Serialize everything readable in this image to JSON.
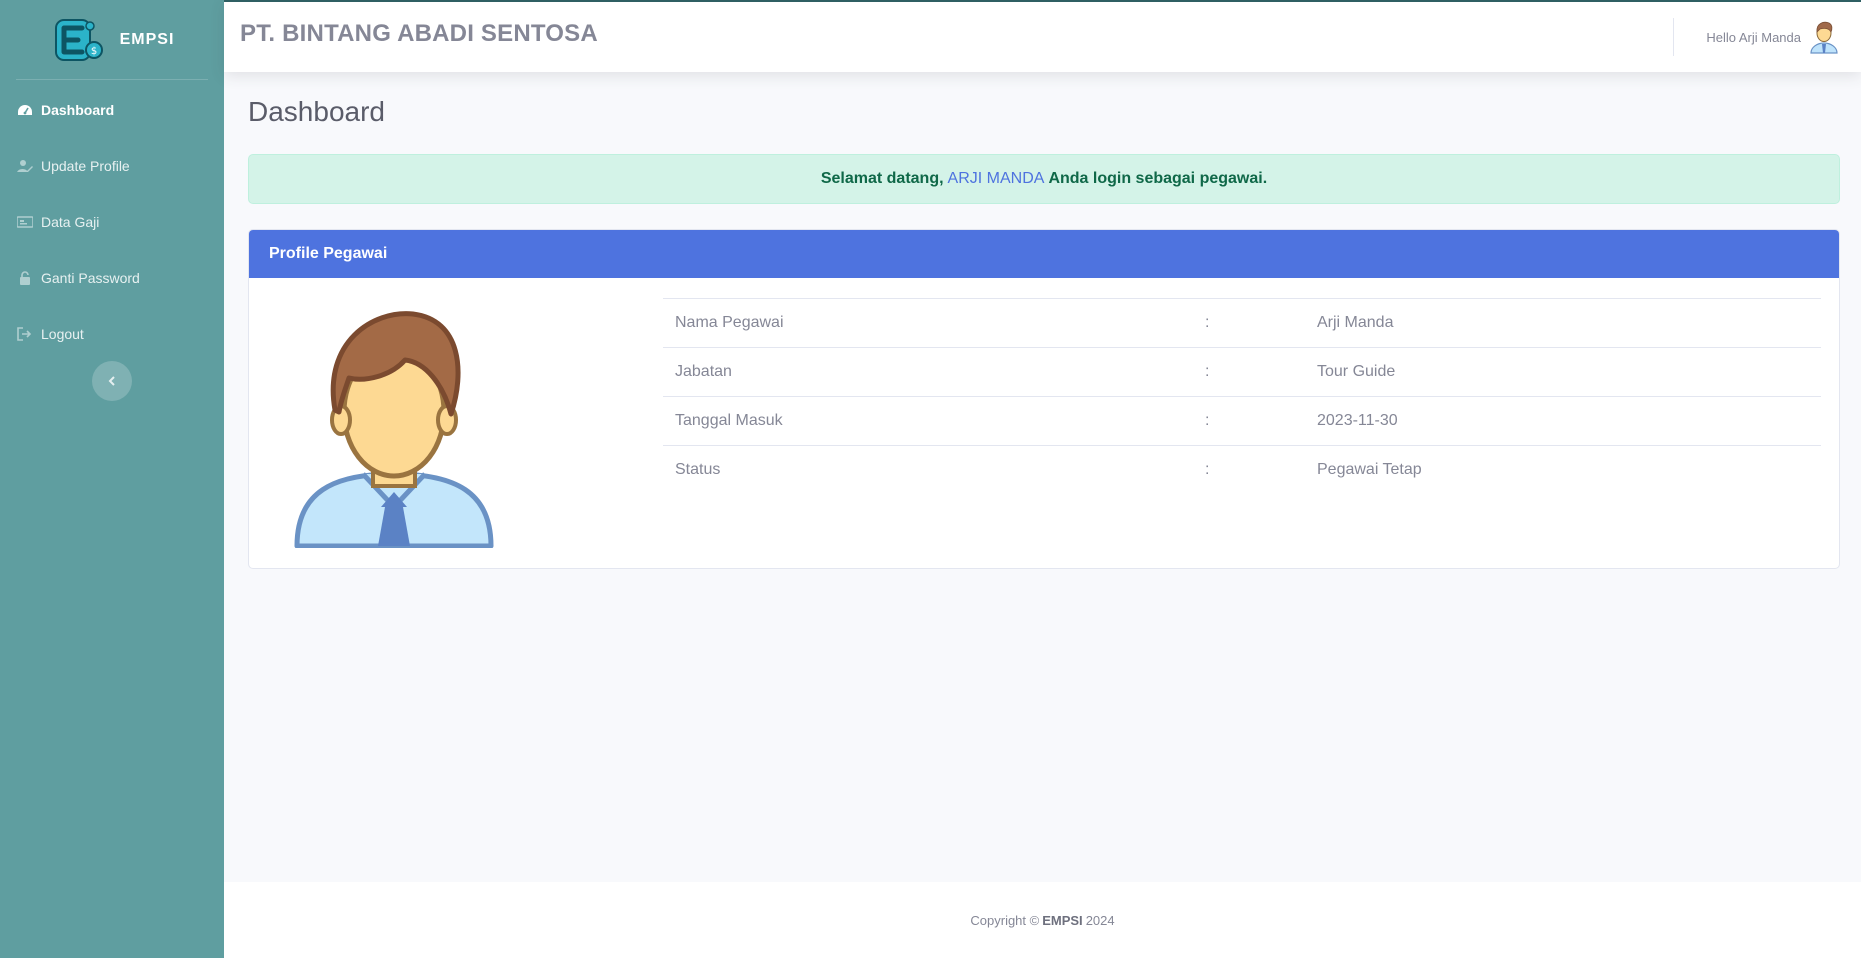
{
  "sidebar": {
    "brand": "EMPSI",
    "items": [
      {
        "label": "Dashboard",
        "icon": "tachometer-icon",
        "active": true
      },
      {
        "label": "Update Profile",
        "icon": "user-edit-icon"
      },
      {
        "label": "Data Gaji",
        "icon": "money-icon"
      },
      {
        "label": "Ganti Password",
        "icon": "lock-icon"
      },
      {
        "label": "Logout",
        "icon": "sign-out-icon"
      }
    ]
  },
  "topbar": {
    "company": "PT. BINTANG ABADI SENTOSA",
    "greeting": "Hello Arji Manda"
  },
  "main": {
    "title": "Dashboard",
    "alert": {
      "prefix": "Selamat datang,",
      "name": "ARJI MANDA",
      "suffix": "Anda login sebagai pegawai."
    },
    "card": {
      "header": "Profile Pegawai",
      "rows": [
        {
          "label": "Nama Pegawai",
          "sep": ":",
          "value": "Arji Manda"
        },
        {
          "label": "Jabatan",
          "sep": ":",
          "value": "Tour Guide"
        },
        {
          "label": "Tanggal Masuk",
          "sep": ":",
          "value": "2023-11-30"
        },
        {
          "label": "Status",
          "sep": ":",
          "value": "Pegawai Tetap"
        }
      ]
    }
  },
  "footer": {
    "prefix": "Copyright ©",
    "brand": "EMPSI",
    "year": "2024"
  },
  "colors": {
    "sidebar": "#5f9ea0",
    "primary": "#4e73df",
    "alert_bg": "#d4f3e8",
    "alert_text": "#0f6848"
  }
}
